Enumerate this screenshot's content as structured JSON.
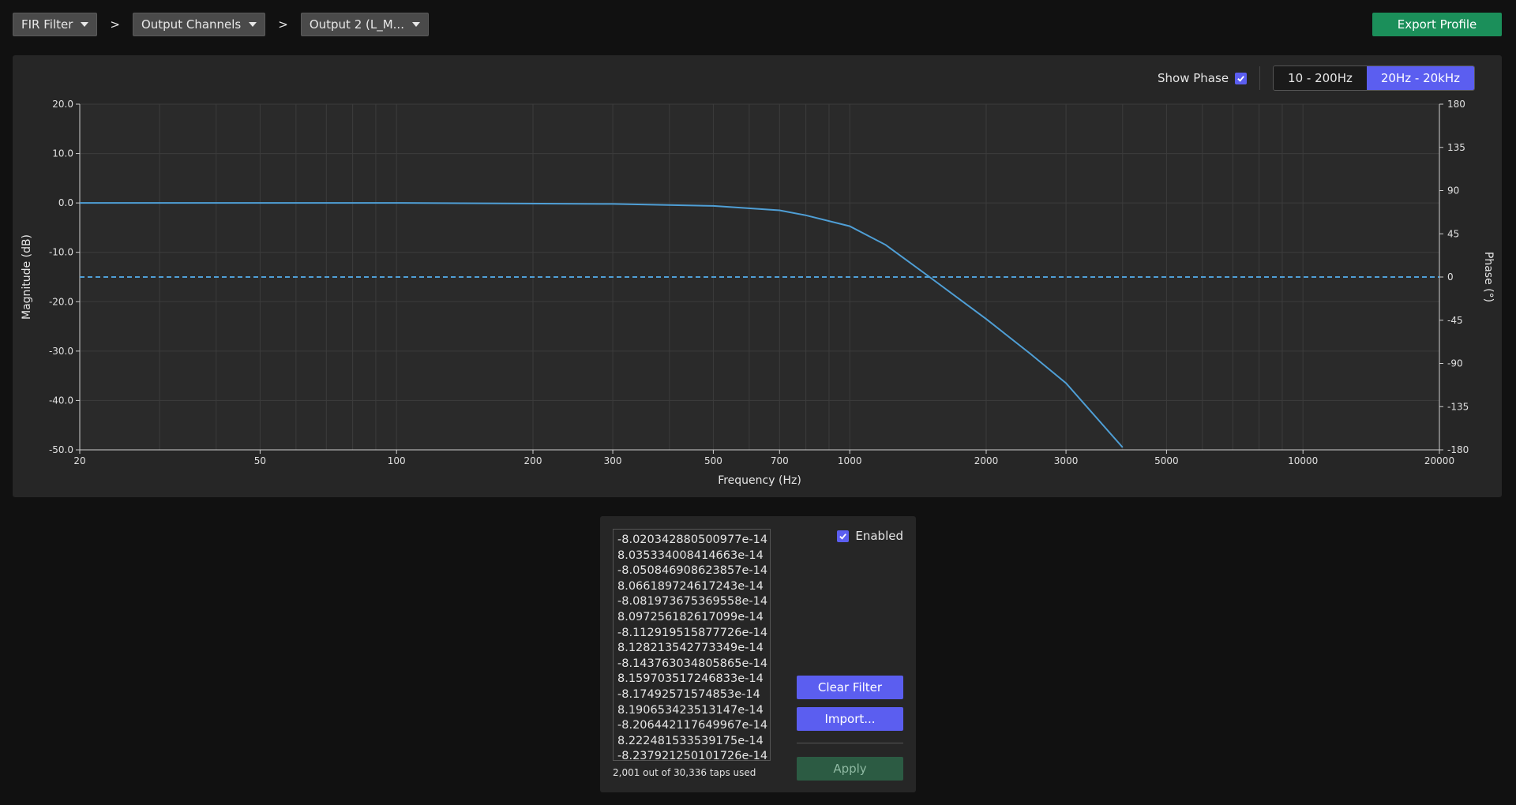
{
  "breadcrumb": {
    "items": [
      {
        "label": "FIR Filter"
      },
      {
        "label": "Output Channels"
      },
      {
        "label": "Output 2 (L_M..."
      }
    ],
    "separator": ">"
  },
  "header": {
    "export_label": "Export Profile"
  },
  "chart_controls": {
    "show_phase_label": "Show Phase",
    "show_phase_checked": true,
    "ranges": [
      "10 - 200Hz",
      "20Hz - 20kHz"
    ],
    "active_range": "20Hz - 20kHz"
  },
  "chart_data": {
    "type": "line",
    "xlabel": "Frequency (Hz)",
    "ylabel": "Magnitude (dB)",
    "y2label": "Phase (°)",
    "x_scale": "log",
    "xlim": [
      20,
      20000
    ],
    "ylim": [
      -50,
      20
    ],
    "y2lim": [
      -180,
      180
    ],
    "x_ticks": [
      20,
      50,
      100,
      200,
      300,
      500,
      700,
      1000,
      2000,
      3000,
      5000,
      10000,
      20000
    ],
    "y_ticks": [
      "20.0",
      "10.0",
      "0.0",
      "-10.0",
      "-20.0",
      "-30.0",
      "-40.0",
      "-50.0"
    ],
    "y2_ticks": [
      "180",
      "135",
      "90",
      "45",
      "0",
      "-45",
      "-90",
      "-135",
      "-180"
    ],
    "grid": true,
    "series": [
      {
        "kind": "magnitude",
        "style": "solid",
        "color": "#4f9fd6",
        "x": [
          20,
          100,
          300,
          500,
          700,
          800,
          1000,
          1200,
          1500,
          2000,
          2500,
          3000,
          4000
        ],
        "y": [
          0,
          0,
          -0.2,
          -0.6,
          -1.5,
          -2.5,
          -4.7,
          -8.5,
          -15,
          -23.5,
          -30.5,
          -36.5,
          -49.5
        ]
      },
      {
        "kind": "phase",
        "style": "dashed",
        "color": "#4f9fd6",
        "x": [
          20,
          20000
        ],
        "y": [
          0,
          0
        ]
      }
    ]
  },
  "taps": {
    "values": [
      "-8.020342880500977e-14",
      "8.035334008414663e-14",
      "-8.050846908623857e-14",
      "8.066189724617243e-14",
      "-8.081973675369558e-14",
      "8.097256182617099e-14",
      "-8.112919515877726e-14",
      "8.128213542773349e-14",
      "-8.143763034805865e-14",
      "8.159703517246833e-14",
      "-8.17492571574853e-14",
      "8.190653423513147e-14",
      "-8.206442117649967e-14",
      "8.222481533539175e-14",
      "-8.237921250101726e-14"
    ],
    "count_label": "2,001 out of 30,336 taps used",
    "enabled_label": "Enabled",
    "enabled_checked": true,
    "clear_label": "Clear Filter",
    "import_label": "Import...",
    "apply_label": "Apply"
  }
}
